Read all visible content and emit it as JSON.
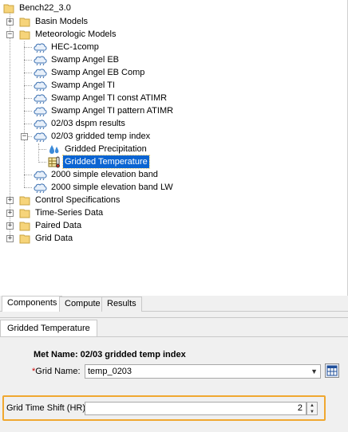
{
  "tree": {
    "root": "Bench22_3.0",
    "basin_models": "Basin Models",
    "met_models": "Meteorologic Models",
    "met_items": [
      "HEC-1comp",
      "Swamp Angel EB",
      "Swamp Angel EB Comp",
      "Swamp Angel TI",
      "Swamp Angel TI const ATIMR",
      "Swamp Angel TI pattern ATIMR",
      "02/03 dspm results",
      "02/03 gridded temp index"
    ],
    "sub_items": [
      "Gridded Precipitation",
      "Gridded Temperature"
    ],
    "met_items_after": [
      "2000 simple elevation band",
      "2000 simple elevation band LW"
    ],
    "control_specs": "Control Specifications",
    "time_series": "Time-Series Data",
    "paired_data": "Paired Data",
    "grid_data": "Grid Data"
  },
  "tabs": [
    "Components",
    "Compute",
    "Results"
  ],
  "editor": {
    "tab": "Gridded Temperature",
    "met_name": "Met Name: 02/03 gridded temp index",
    "grid_name_label": "Grid Name:",
    "required_mark": "*",
    "grid_name_value": "temp_0203",
    "shift_label": "Grid Time Shift (HR)",
    "shift_value": "2"
  },
  "colors": {
    "selection": "#0a64d2",
    "highlight": "#f0a830",
    "folder": "#f6d47a"
  }
}
